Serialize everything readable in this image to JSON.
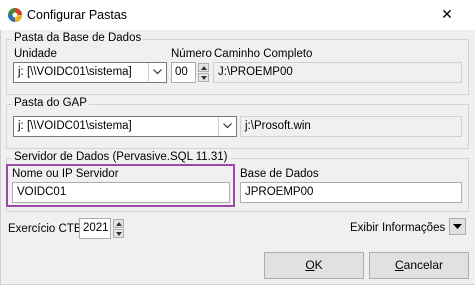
{
  "window": {
    "title": "Configurar Pastas",
    "close_glyph": "✕",
    "icon": "app-icon"
  },
  "base_dados": {
    "legend": "Pasta da Base de Dados",
    "unidade_label": "Unidade",
    "unidade_value": "j: [\\\\VOIDC01\\sistema]",
    "numero_label": "Número",
    "numero_value": "00",
    "caminho_label": "Caminho Completo",
    "caminho_value": "J:\\PROEMP00"
  },
  "gap": {
    "legend": "Pasta do GAP",
    "unidade_value": "j: [\\\\VOIDC01\\sistema]",
    "path_value": "j:\\Prosoft.win"
  },
  "servidor": {
    "legend": "Servidor de Dados (Pervasive.SQL 11.31)",
    "nome_label": "Nome ou IP Servidor",
    "nome_value": "VOIDC01",
    "base_label": "Base de Dados",
    "base_value": "JPROEMP00"
  },
  "exercicio": {
    "label": "Exercício CTB",
    "value": "2021"
  },
  "exibir_label": "Exibir Informações",
  "buttons": {
    "ok_accel": "O",
    "ok_rest": "K",
    "cancel_accel": "C",
    "cancel_rest": "ancelar"
  }
}
